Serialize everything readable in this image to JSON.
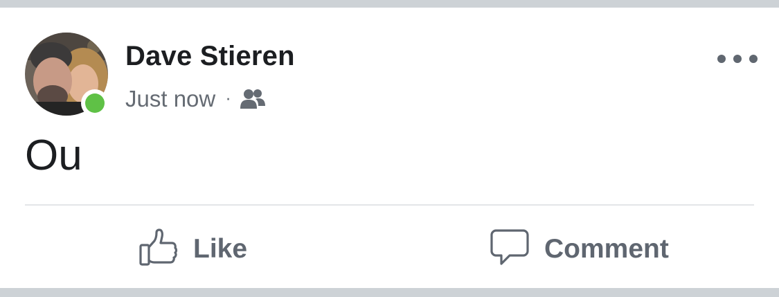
{
  "post": {
    "author": "Dave Stieren",
    "timestamp": "Just now",
    "separator": "·",
    "audience_icon": "friends-icon",
    "more_icon": "more-options-icon",
    "body_text": "Ou",
    "online_status": "online",
    "online_color": "#5fc146"
  },
  "actions": {
    "like_label": "Like",
    "like_icon": "thumbs-up-icon",
    "comment_label": "Comment",
    "comment_icon": "speech-bubble-icon"
  },
  "colors": {
    "text_primary": "#1c1e21",
    "text_secondary": "#656b73",
    "background": "#ffffff",
    "separator_bar": "#cdd2d6"
  }
}
